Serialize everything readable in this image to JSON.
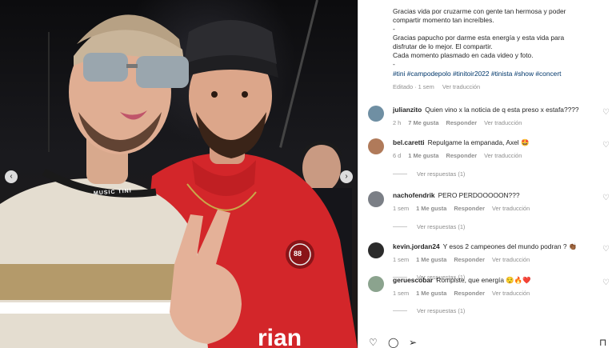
{
  "post": {
    "caption_lines": [
      "Gracias vida por cruzarme con gente tan hermosa y poder",
      "compartir momento tan increíbles.",
      "-",
      "Gracias papucho por darme esta energía y esta vida para",
      "disfrutar de lo mejor. El compartir.",
      "Cada momento plasmado en cada video y foto."
    ],
    "separator": "-",
    "hashtags": "#tini #campodepolo #tinitoir2022 #tinista #show #concert",
    "edited": "Editado · 1 sem",
    "see_translation": "Ver traducción",
    "photo_text": {
      "lanyard": "MUSIC  TINI",
      "badge": "88",
      "shirt_brand": "rian"
    }
  },
  "comments": [
    {
      "user": "julianzito",
      "text": "Quien vino x la noticia de q esta preso x estafa????",
      "age": "2 h",
      "likes": "7 Me gusta",
      "reply": "Responder",
      "translate": "Ver traducción",
      "avatar_color": "#6f8fa3"
    },
    {
      "user": "bel.caretti",
      "text": "Repulgame la empanada, Axel 🤩",
      "age": "6 d",
      "likes": "1 Me gusta",
      "reply": "Responder",
      "translate": "Ver traducción",
      "replies": "Ver respuestas (1)",
      "avatar_color": "#b07a5a"
    },
    {
      "user": "nachofendrik",
      "text": "PERO PERDOOOOON???",
      "age": "1 sem",
      "likes": "1 Me gusta",
      "reply": "Responder",
      "translate": "Ver traducción",
      "replies": "Ver respuestas (1)",
      "avatar_color": "#7b7f86"
    },
    {
      "user": "kevin.jordan24",
      "text": "Y esos 2 campeones del mundo podran ? 👏🏾",
      "age": "1 sem",
      "likes": "1 Me gusta",
      "reply": "Responder",
      "translate": "Ver traducción",
      "replies": "Ver respuestas (1)",
      "avatar_color": "#2b2b2b"
    },
    {
      "user": "geruescobar",
      "text": "Rompiste, que energía 😌🔥❤️",
      "age": "1 sem",
      "likes": "1 Me gusta",
      "reply": "Responder",
      "translate": "Ver traducción",
      "replies": "Ver respuestas (1)",
      "avatar_color": "#8ba38e"
    }
  ],
  "icons": {
    "like": "♡",
    "comment": "◯",
    "share": "➢",
    "save": "⊓",
    "prev": "‹",
    "next": "›"
  }
}
